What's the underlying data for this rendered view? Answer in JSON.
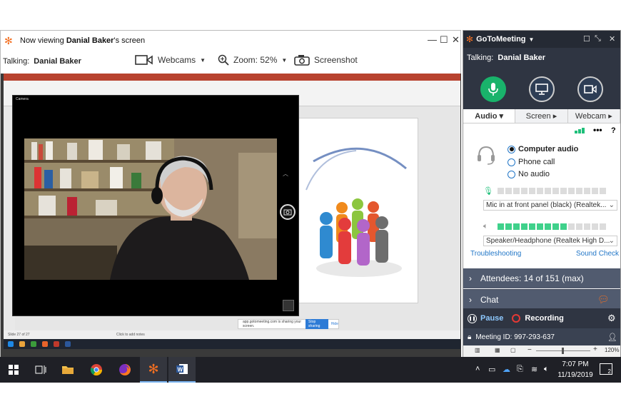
{
  "viewer": {
    "title_prefix": "Now viewing",
    "title_name": "Danial Baker",
    "title_suffix": "'s screen",
    "talking_label": "Talking:",
    "talking_name": "Danial Baker",
    "webcams_label": "Webcams",
    "zoom_label": "Zoom: 52%",
    "screenshot_label": "Screenshot"
  },
  "shared_screen": {
    "camera_caption": "Camera",
    "status_text": "Slide 27 of 27",
    "notes_text": "Click to add notes",
    "share_note_text": "app.gotomeeting.com is sharing your screen.",
    "stop_sharing_label": "Stop sharing",
    "hide_label": "Hide"
  },
  "panel": {
    "brand": "GoToMeeting",
    "talking_label": "Talking:",
    "talking_name": "Danial Baker",
    "tabs": [
      {
        "label": "Audio",
        "arrow": "▾"
      },
      {
        "label": "Screen",
        "arrow": "▸"
      },
      {
        "label": "Webcam",
        "arrow": "▸"
      }
    ],
    "audio_options": [
      {
        "label": "Computer audio",
        "selected": true
      },
      {
        "label": "Phone call",
        "selected": false
      },
      {
        "label": "No audio",
        "selected": false
      }
    ],
    "mic_device": "Mic in at front panel (black) (Realtek...",
    "speaker_device": "Speaker/Headphone (Realtek High D...",
    "mic_level": 0,
    "speaker_level": 0.62,
    "troubleshooting_label": "Troubleshooting",
    "sound_check_label": "Sound Check",
    "attendees_label": "Attendees:  14 of 151 (max)",
    "chat_label": "Chat",
    "pause_label": "Pause",
    "recording_label": "Recording",
    "meeting_id_label": "Meeting ID: 997-293-637",
    "zoom_level": "120%"
  },
  "taskbar": {
    "time": "7:07 PM",
    "date": "11/19/2019",
    "notification_count": "2",
    "apps": [
      "start-icon",
      "task-view-icon",
      "file-explorer-icon",
      "chrome-icon",
      "firefox-icon",
      "gotomeeting-icon",
      "word-icon"
    ]
  },
  "colors": {
    "accent_orange": "#f36f21",
    "mic_green": "#1fbf7a",
    "panel_dark": "#2f3542",
    "section_gray": "#515b6f",
    "link_blue": "#2176c7",
    "record_red": "#e53935"
  }
}
